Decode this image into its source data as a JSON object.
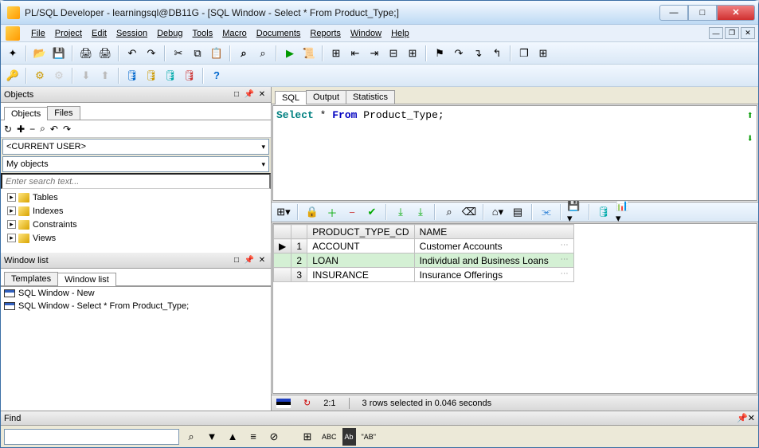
{
  "title": "PL/SQL Developer - learningsql@DB11G - [SQL Window - Select * From Product_Type;]",
  "menus": [
    "File",
    "Project",
    "Edit",
    "Session",
    "Debug",
    "Tools",
    "Macro",
    "Documents",
    "Reports",
    "Window",
    "Help"
  ],
  "objects": {
    "panel_title": "Objects",
    "tabs": [
      "Objects",
      "Files"
    ],
    "current_user": "<CURRENT USER>",
    "scope": "My objects",
    "search_placeholder": "Enter search text...",
    "tree": [
      "Tables",
      "Indexes",
      "Constraints",
      "Views"
    ]
  },
  "window_list": {
    "panel_title": "Window list",
    "tabs": [
      "Templates",
      "Window list"
    ],
    "items": [
      "SQL Window - New",
      "SQL Window - Select * From Product_Type;"
    ]
  },
  "sql": {
    "tabs": [
      "SQL",
      "Output",
      "Statistics"
    ],
    "query_select": "Select",
    "query_star": "*",
    "query_from": "From",
    "query_table": "Product_Type",
    "query_semi": ";"
  },
  "grid": {
    "columns": [
      "PRODUCT_TYPE_CD",
      "NAME"
    ],
    "rows": [
      {
        "n": "1",
        "cd": "ACCOUNT",
        "name": "Customer Accounts"
      },
      {
        "n": "2",
        "cd": "LOAN",
        "name": "Individual and Business Loans"
      },
      {
        "n": "3",
        "cd": "INSURANCE",
        "name": "Insurance Offerings"
      }
    ]
  },
  "status": {
    "pos": "2:1",
    "msg": "3 rows selected in 0.046 seconds"
  },
  "find": {
    "label": "Find",
    "abc": "ABC",
    "ab2": "\"AB\""
  }
}
